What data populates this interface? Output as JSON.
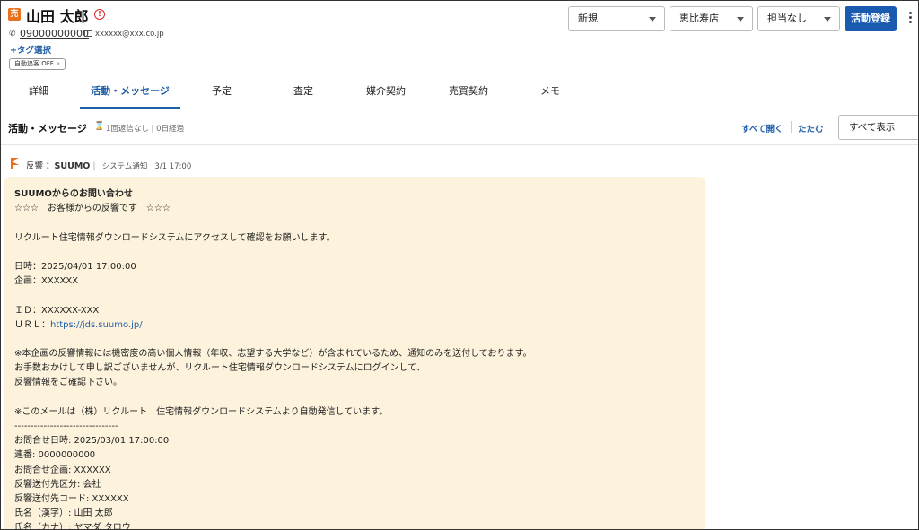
{
  "customer": {
    "type_badge": "売",
    "name": "山田 太郎",
    "alert_icon": "!",
    "phone": "09000000000",
    "email": "xxxxxx@xxx.co.jp",
    "tag_select": "+タグ選択",
    "auto_chase": "自動追客 OFF",
    "auto_chase_chevron": "›"
  },
  "toolbar": {
    "status": "新規",
    "store": "恵比寿店",
    "staff": "担当なし",
    "register": "活動登録"
  },
  "tabs": [
    "詳細",
    "活動・メッセージ",
    "予定",
    "査定",
    "媒介契約",
    "売買契約",
    "メモ"
  ],
  "section": {
    "title": "活動・メッセージ",
    "meta": "1回返信なし | 0日経過",
    "expand_all": "すべて開く",
    "collapse_all": "たたむ",
    "filter": "すべて表示"
  },
  "activity": {
    "label": "反響",
    "source": "：SUUMO",
    "kind": "システム通知",
    "datetime": "3/1 17:00",
    "title": "SUUMOからのお問い合わせ",
    "lines": [
      "☆☆☆　お客様からの反響です　☆☆☆",
      "",
      "リクルート住宅情報ダウンロードシステムにアクセスして確認をお願いします。",
      "",
      "日時：2025/04/01 17:00:00",
      "企画：XXXXXX",
      "",
      "ＩＤ：XXXXXX-XXX",
      "ＵＲＬ：",
      "",
      "※本企画の反響情報には機密度の高い個人情報（年収、志望する大学など）が含まれているため、通知のみを送付しております。",
      "お手数おかけして申し訳ございませんが、リクルート住宅情報ダウンロードシステムにログインして、",
      "反響情報をご確認下さい。",
      "",
      "※このメールは（株）リクルート　住宅情報ダウンロードシステムより自動発信しています。",
      "--------------------------------",
      "お問合せ日時: 2025/03/01 17:00:00",
      "連番: 0000000000",
      "お問合せ企画: XXXXXX",
      "反響送付先区分: 会社",
      "反響送付先コード: XXXXXX",
      "氏名（漢字）: 山田 太郎",
      "氏名（カナ）: ヤマダ タロウ"
    ],
    "url_link": "https://jds.suumo.jp/"
  }
}
